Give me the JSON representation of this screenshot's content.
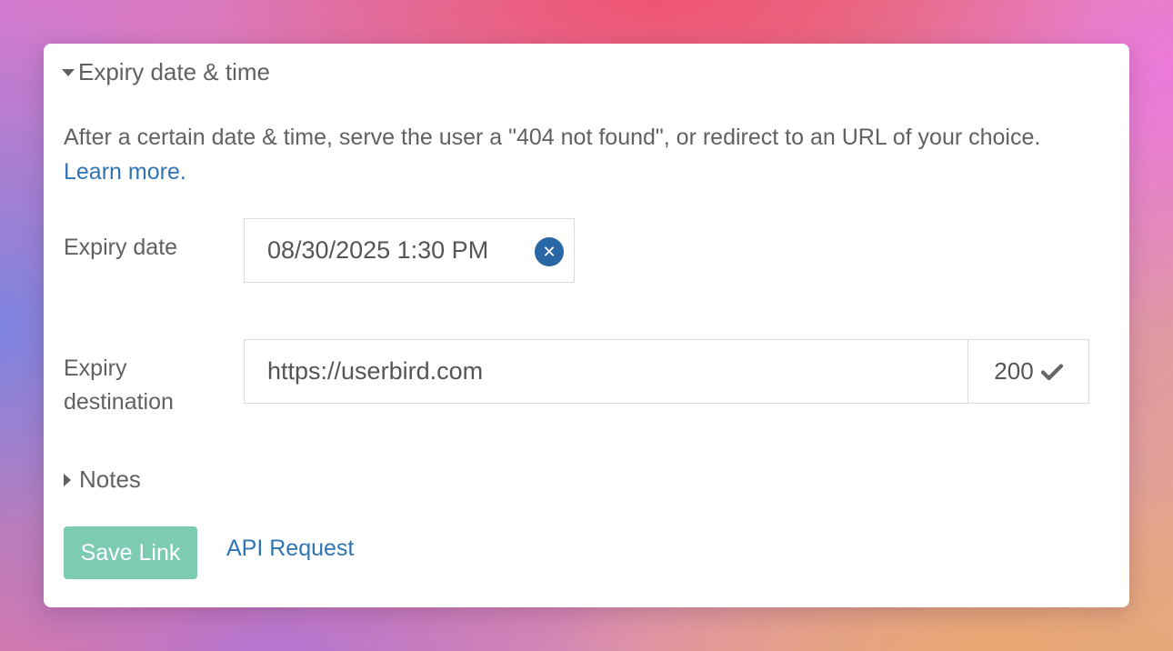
{
  "section": {
    "title": "Expiry date & time",
    "description": "After a certain date & time, serve the user a \"404 not found\", or redirect to an URL of your choice.",
    "learn_more": "Learn more."
  },
  "expiry_date": {
    "label": "Expiry date",
    "value": "08/30/2025 1:30 PM",
    "clear_icon": "close-circle-icon"
  },
  "expiry_destination": {
    "label": "Expiry destination",
    "value": "https://userbird.com",
    "status_code": "200",
    "status_icon": "check-icon"
  },
  "notes": {
    "title": "Notes"
  },
  "actions": {
    "save_label": "Save Link",
    "api_label": "API Request"
  },
  "colors": {
    "accent_link": "#2f75b5",
    "save_button": "#7ccbb2",
    "clear_button": "#2866a6"
  }
}
